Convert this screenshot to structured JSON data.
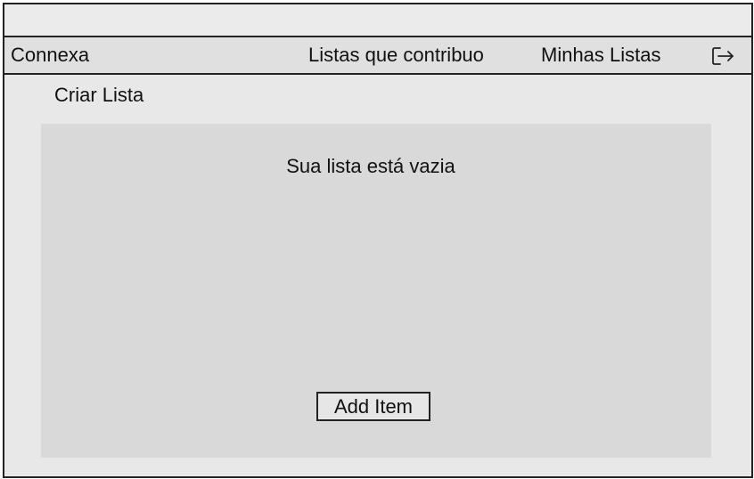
{
  "navbar": {
    "brand": "Connexa",
    "links": [
      {
        "label": "Listas que contribuo"
      },
      {
        "label": "Minhas Listas"
      }
    ],
    "logout_icon": "logout-icon"
  },
  "main": {
    "create_list_label": "Criar Lista",
    "empty_message": "Sua lista está vazia",
    "add_item_label": "Add Item"
  },
  "colors": {
    "background": "#e8e8e8",
    "panel": "#d9d9d9",
    "border": "#222222"
  }
}
